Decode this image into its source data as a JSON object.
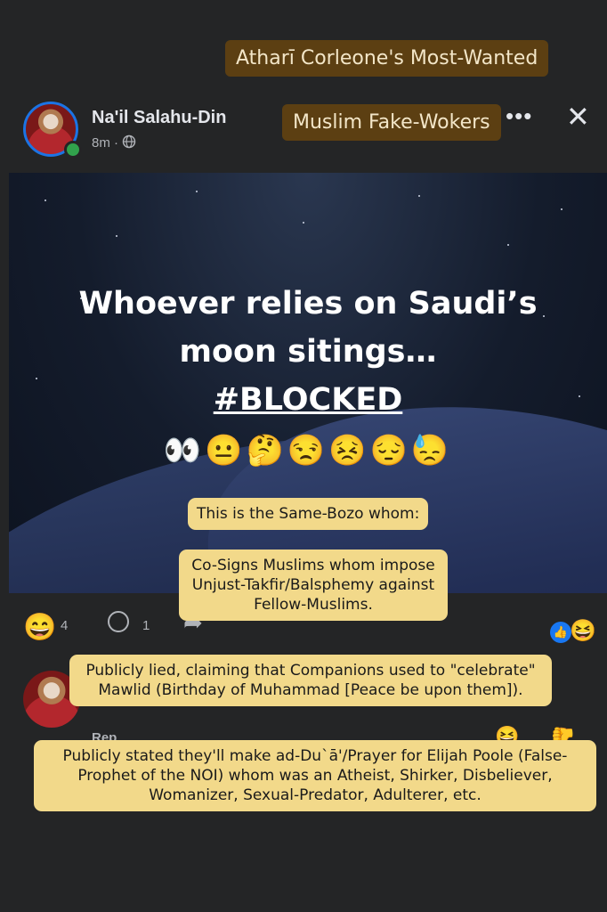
{
  "stickers": {
    "title": "Atharī Corleone's Most-Wanted",
    "subtitle": "Muslim Fake-Wokers",
    "note1": "This is the Same-Bozo whom:",
    "note2": "Co-Signs Muslims whom impose Unjust-Takfir/Balsphemy against Fellow-Muslims.",
    "note3": "Publicly lied, claiming that Companions used to \"celebrate\" Mawlid (Birthday of Muhammad [Peace be upon them]).",
    "note4": "Publicly stated they'll make ad-Du`ā'/Prayer for Elijah Poole (False-Prophet of the NOI) whom was an Atheist, Shirker, Disbeliever, Womanizer, Sexual-Predator, Adulterer, etc."
  },
  "post": {
    "author": "Na'il Salahu-Din",
    "time": "8m",
    "privacy_icon": "globe-icon",
    "more_label": "•••",
    "close_label": "✕",
    "headline_line1": "Whoever relies on Saudi’s",
    "headline_line2": "moon sitings…",
    "headline_tag": "#BLOCKED",
    "emojis": "👀😐🤔😒😣😔😓"
  },
  "reactions": {
    "count": "4",
    "comments": "1",
    "reaction_emoji": "😄",
    "badge_emoji": "😆"
  },
  "comment": {
    "reply_label": "Rep"
  },
  "colors": {
    "background": "#242526",
    "accent_blue": "#1877f2",
    "sticker_brown": "#5c3f12",
    "sticker_yellow": "#f2d98a"
  }
}
